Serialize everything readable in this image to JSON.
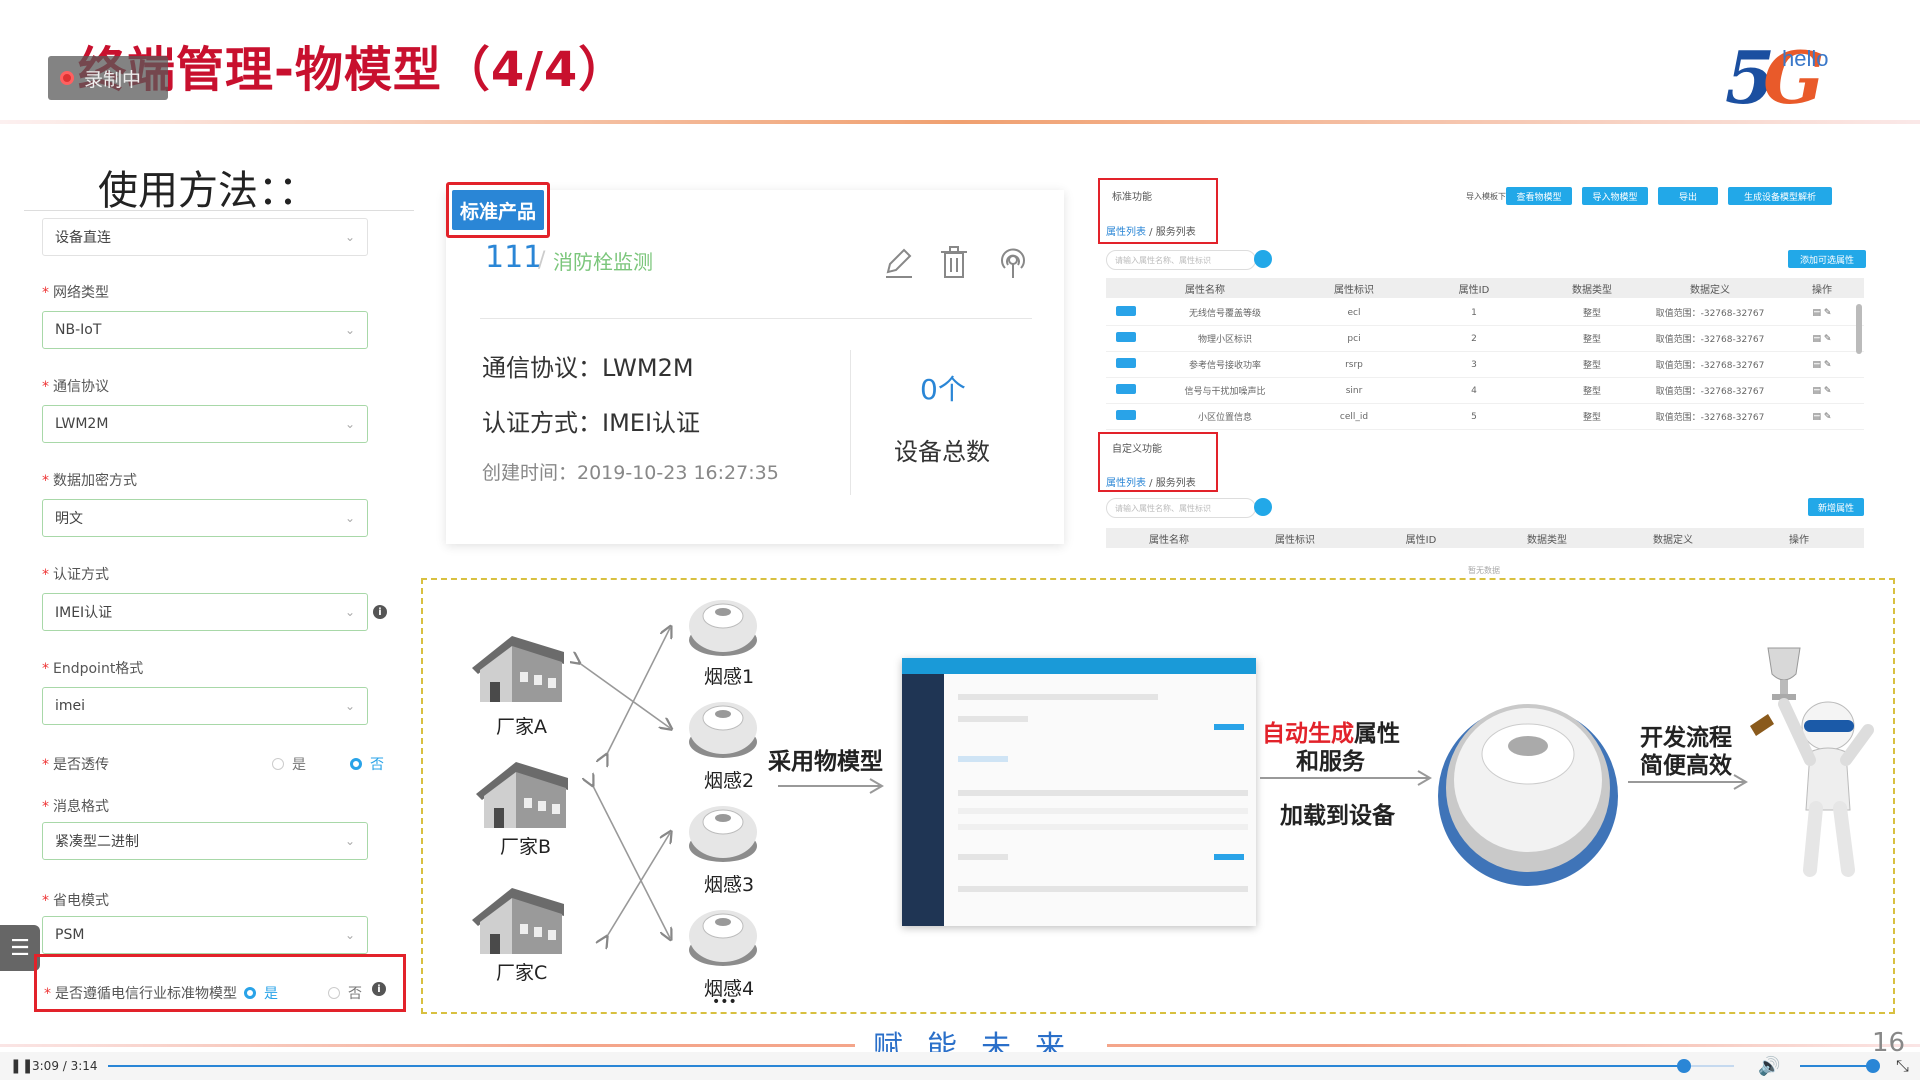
{
  "header": {
    "title": "终端管理-物模型（4/4）",
    "recording": "录制中",
    "logo_num": "5",
    "logo_g": "G",
    "logo_word": "hello"
  },
  "form": {
    "usage_title": "使用方法：：",
    "connection": "设备直连",
    "fields": [
      {
        "label": "网络类型",
        "value": "NB-IoT"
      },
      {
        "label": "通信协议",
        "value": "LWM2M"
      },
      {
        "label": "数据加密方式",
        "value": "明文"
      },
      {
        "label": "认证方式",
        "value": "IMEI认证"
      },
      {
        "label": "Endpoint格式",
        "value": "imei"
      },
      {
        "label": "消息格式",
        "value": "紧凑型二进制"
      },
      {
        "label": "省电模式",
        "value": "PSM"
      }
    ],
    "passthrough": {
      "label": "是否透传",
      "yes": "是",
      "no": "否"
    },
    "standard_model": {
      "label": "是否遵循电信行业标准物模型",
      "yes": "是",
      "no": "否"
    }
  },
  "product": {
    "tag": "标准产品",
    "id": "111",
    "sep": "/",
    "name": "消防栓监测",
    "protocol": "通信协议：LWM2M",
    "auth": "认证方式：IMEI认证",
    "created": "创建时间：2019-10-23 16:27:35",
    "device_count": "0个",
    "device_count_label": "设备总数"
  },
  "model_panel": {
    "std_title": "标准功能",
    "custom_title": "自定义功能",
    "tab_props": "属性列表",
    "tab_sep": " / ",
    "tab_services": "服务列表",
    "import_tpl": "导入模板下载",
    "buttons": [
      "查看物模型",
      "导入物模型",
      "导出",
      "生成设备模型解析"
    ],
    "search_placeholder": "请输入属性名称、属性标识",
    "add_prop": "添加可选属性",
    "new_prop": "新增属性",
    "columns": [
      "属性名称",
      "属性标识",
      "属性ID",
      "数据类型",
      "数据定义",
      "操作"
    ],
    "rows": [
      {
        "name": "无线信号覆盖等级",
        "key": "ecl",
        "id": "1",
        "type": "整型",
        "def": "取值范围：-32768-32767"
      },
      {
        "name": "物理小区标识",
        "key": "pci",
        "id": "2",
        "type": "整型",
        "def": "取值范围：-32768-32767"
      },
      {
        "name": "参考信号接收功率",
        "key": "rsrp",
        "id": "3",
        "type": "整型",
        "def": "取值范围：-32768-32767"
      },
      {
        "name": "信号与干扰加噪声比",
        "key": "sinr",
        "id": "4",
        "type": "整型",
        "def": "取值范围：-32768-32767"
      },
      {
        "name": "小区位置信息",
        "key": "cell_id",
        "id": "5",
        "type": "整型",
        "def": "取值范围：-32768-32767"
      }
    ],
    "empty": "暂无数据"
  },
  "diagram": {
    "factories": [
      "厂家A",
      "厂家B",
      "厂家C"
    ],
    "smoke": [
      "烟感1",
      "烟感2",
      "烟感3",
      "烟感4"
    ],
    "ellipsis": "•••",
    "use_model": "采用物模型",
    "auto_red": "自动生成",
    "auto_rest": "属性",
    "and_services": "和服务",
    "load": "加载到设备",
    "dev_line1": "开发流程",
    "dev_line2": "简便高效"
  },
  "footer": {
    "slogan": "赋能未来",
    "page": "16"
  },
  "player": {
    "time": "3:09 / 3:14",
    "progress": 0.969
  }
}
